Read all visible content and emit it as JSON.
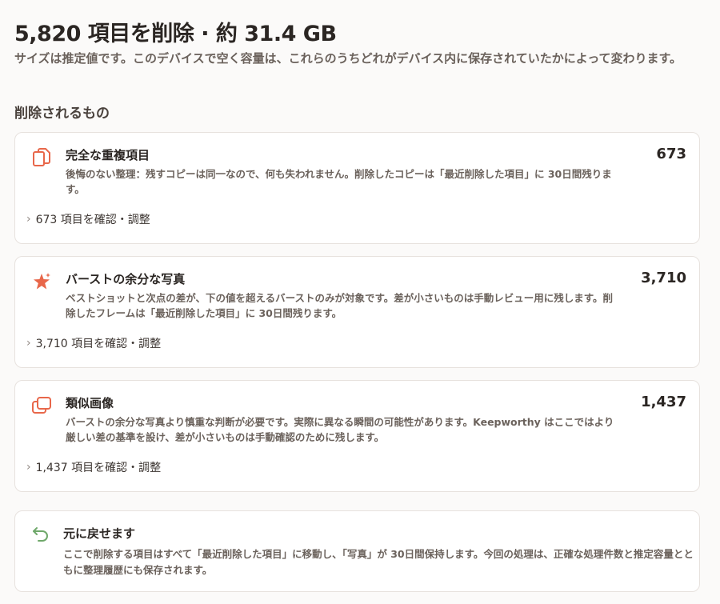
{
  "header": {
    "title": "5,820 項目を削除 · 約 31.4 GB",
    "subtitle": "サイズは推定値です。このデバイスで空く容量は、これらのうちどれがデバイス内に保存されていたかによって変わります。"
  },
  "section": {
    "heading": "削除されるもの"
  },
  "cards": [
    {
      "icon": "duplicate-copy-icon",
      "title": "完全な重複項目",
      "count": "673",
      "desc": "後悔のない整理：残すコピーは同一なので、何も失われません。削除したコピーは「最近削除した項目」に 30日間残ります。",
      "link": "673 項目を確認・調整"
    },
    {
      "icon": "burst-star-icon",
      "title": "バーストの余分な写真",
      "count": "3,710",
      "desc": "ベストショットと次点の差が、下の値を超えるバーストのみが対象です。差が小さいものは手動レビュー用に残します。削除したフレームは「最近削除した項目」に 30日間残ります。",
      "link": "3,710 項目を確認・調整"
    },
    {
      "icon": "similar-images-icon",
      "title": "類似画像",
      "count": "1,437",
      "desc": "バーストの余分な写真より慎重な判断が必要です。実際に異なる瞬間の可能性があります。Keepworthy はここではより厳しい差の基準を設け、差が小さいものは手動確認のために残します。",
      "link": "1,437 項目を確認・調整"
    }
  ],
  "undo": {
    "icon": "undo-arrow-icon",
    "title": "元に戻せます",
    "desc": "ここで削除する項目はすべて「最近削除した項目」に移動し、「写真」が 30日間保持します。今回の処理は、正確な処理件数と推定容量とともに整理履歴にも保存されます。"
  },
  "colors": {
    "accent": "#e8674a",
    "undo": "#6fa86a"
  }
}
